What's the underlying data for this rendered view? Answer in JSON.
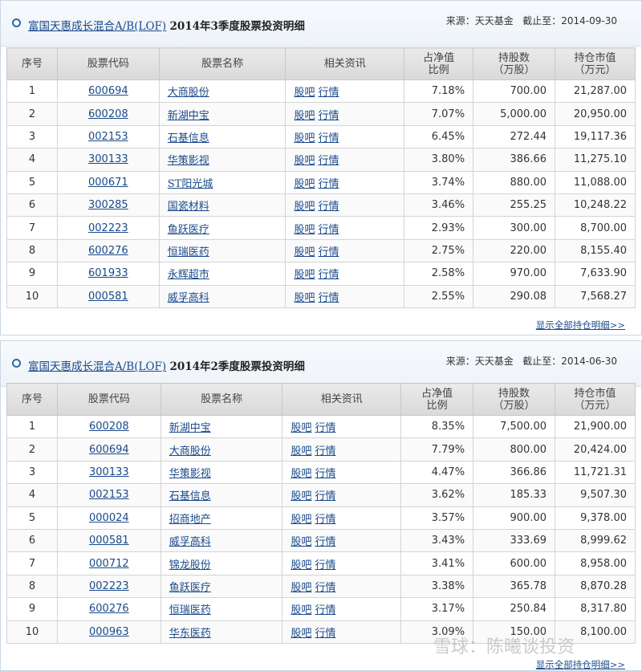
{
  "panels": [
    {
      "fund_name": "富国天惠成长混合A/B(LOF)",
      "quarter_title": "2014年3季度股票投资明细",
      "source_label": "来源：",
      "source": "天天基金",
      "date_label": "截止至：",
      "date": "2014-09-30",
      "more_link": "显示全部持仓明细>>",
      "rows": [
        {
          "idx": "1",
          "code": "600694",
          "name": "大商股份",
          "ratio": "7.18%",
          "shares": "700.00",
          "value": "21,287.00"
        },
        {
          "idx": "2",
          "code": "600208",
          "name": "新湖中宝",
          "ratio": "7.07%",
          "shares": "5,000.00",
          "value": "20,950.00"
        },
        {
          "idx": "3",
          "code": "002153",
          "name": "石基信息",
          "ratio": "6.45%",
          "shares": "272.44",
          "value": "19,117.36"
        },
        {
          "idx": "4",
          "code": "300133",
          "name": "华策影视",
          "ratio": "3.80%",
          "shares": "386.66",
          "value": "11,275.10"
        },
        {
          "idx": "5",
          "code": "000671",
          "name": "ST阳光城",
          "ratio": "3.74%",
          "shares": "880.00",
          "value": "11,088.00"
        },
        {
          "idx": "6",
          "code": "300285",
          "name": "国瓷材料",
          "ratio": "3.46%",
          "shares": "255.25",
          "value": "10,248.22"
        },
        {
          "idx": "7",
          "code": "002223",
          "name": "鱼跃医疗",
          "ratio": "2.93%",
          "shares": "300.00",
          "value": "8,700.00"
        },
        {
          "idx": "8",
          "code": "600276",
          "name": "恒瑞医药",
          "ratio": "2.75%",
          "shares": "220.00",
          "value": "8,155.40"
        },
        {
          "idx": "9",
          "code": "601933",
          "name": "永辉超市",
          "ratio": "2.58%",
          "shares": "970.00",
          "value": "7,633.90"
        },
        {
          "idx": "10",
          "code": "000581",
          "name": "威孚高科",
          "ratio": "2.55%",
          "shares": "290.08",
          "value": "7,568.27"
        }
      ]
    },
    {
      "fund_name": "富国天惠成长混合A/B(LOF)",
      "quarter_title": "2014年2季度股票投资明细",
      "source_label": "来源：",
      "source": "天天基金",
      "date_label": "截止至：",
      "date": "2014-06-30",
      "more_link": "显示全部持仓明细>>",
      "rows": [
        {
          "idx": "1",
          "code": "600208",
          "name": "新湖中宝",
          "ratio": "8.35%",
          "shares": "7,500.00",
          "value": "21,900.00"
        },
        {
          "idx": "2",
          "code": "600694",
          "name": "大商股份",
          "ratio": "7.79%",
          "shares": "800.00",
          "value": "20,424.00"
        },
        {
          "idx": "3",
          "code": "300133",
          "name": "华策影视",
          "ratio": "4.47%",
          "shares": "366.86",
          "value": "11,721.31"
        },
        {
          "idx": "4",
          "code": "002153",
          "name": "石基信息",
          "ratio": "3.62%",
          "shares": "185.33",
          "value": "9,507.30"
        },
        {
          "idx": "5",
          "code": "000024",
          "name": "招商地产",
          "ratio": "3.57%",
          "shares": "900.00",
          "value": "9,378.00"
        },
        {
          "idx": "6",
          "code": "000581",
          "name": "威孚高科",
          "ratio": "3.43%",
          "shares": "333.69",
          "value": "8,999.62"
        },
        {
          "idx": "7",
          "code": "000712",
          "name": "锦龙股份",
          "ratio": "3.41%",
          "shares": "600.00",
          "value": "8,958.00"
        },
        {
          "idx": "8",
          "code": "002223",
          "name": "鱼跃医疗",
          "ratio": "3.38%",
          "shares": "365.78",
          "value": "8,870.28"
        },
        {
          "idx": "9",
          "code": "600276",
          "name": "恒瑞医药",
          "ratio": "3.17%",
          "shares": "250.84",
          "value": "8,317.80"
        },
        {
          "idx": "10",
          "code": "000963",
          "name": "华东医药",
          "ratio": "3.09%",
          "shares": "150.00",
          "value": "8,100.00"
        }
      ]
    }
  ],
  "columns": {
    "idx": "序号",
    "code": "股票代码",
    "name": "股票名称",
    "info": "相关资讯",
    "ratio_1": "占净值",
    "ratio_2": "比例",
    "shares_1": "持股数",
    "shares_2": "（万股）",
    "value_1": "持仓市值",
    "value_2": "（万元）"
  },
  "info_links": {
    "forum": "股吧",
    "quote": "行情"
  },
  "watermark": "雪球：陈曦谈投资",
  "colors": {
    "link": "#1a4a8a",
    "header_bg": "#eef3f8",
    "border": "#c9d6e3"
  }
}
